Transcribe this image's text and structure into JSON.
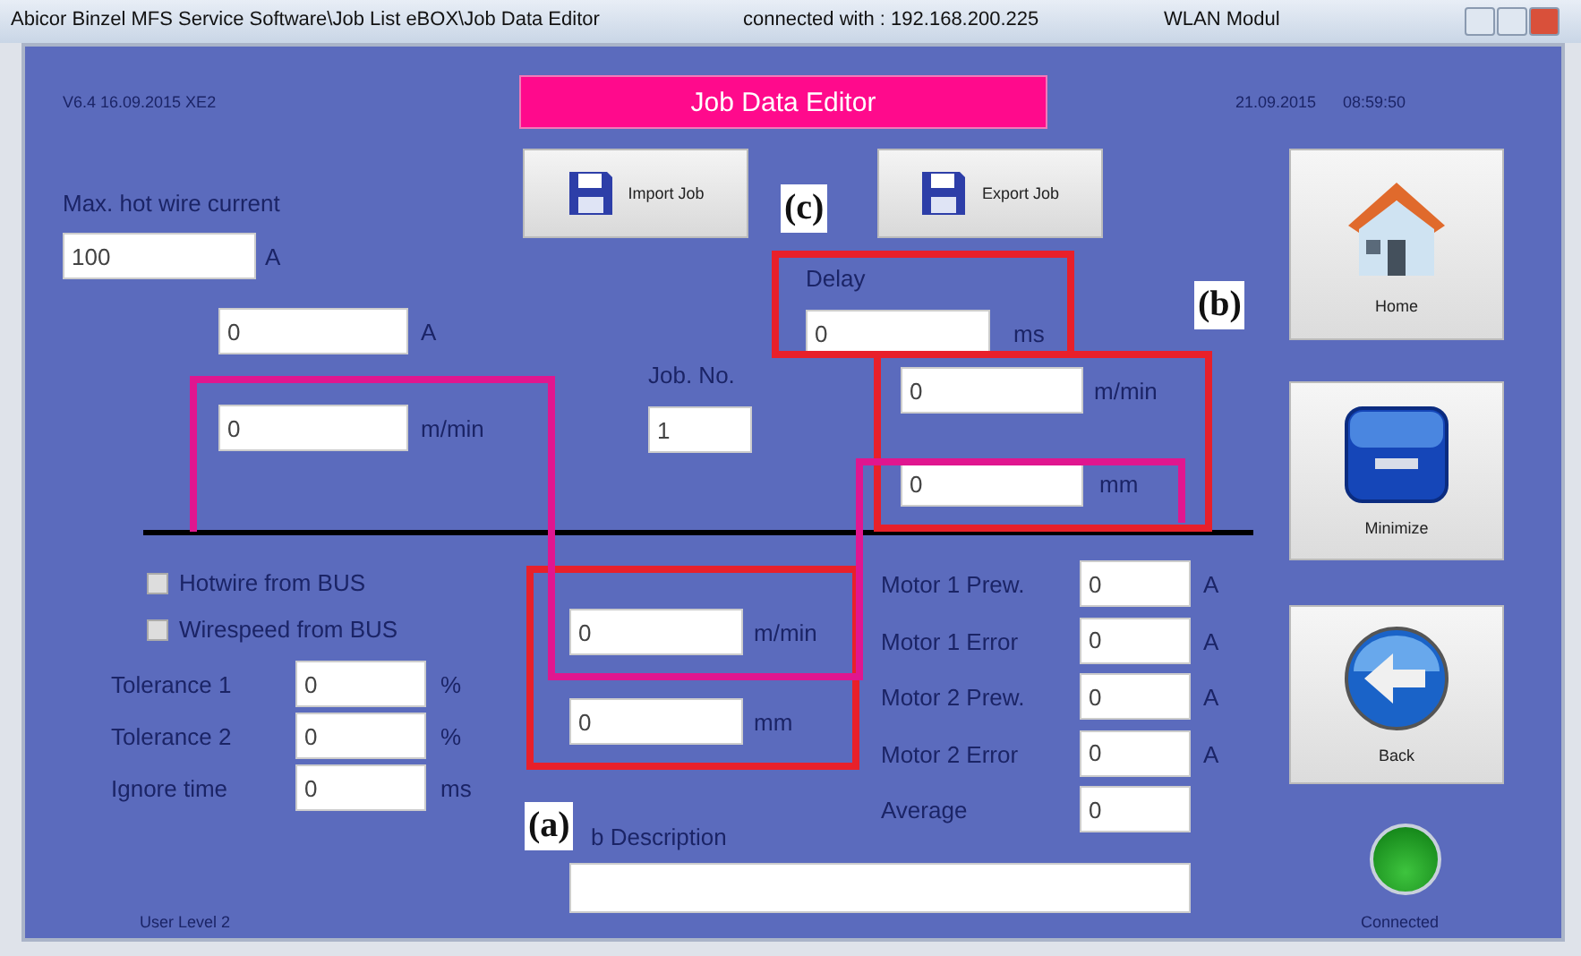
{
  "window": {
    "title": "Abicor Binzel MFS Service Software\\Job List eBOX\\Job Data Editor",
    "connection": "connected with : 192.168.200.225",
    "module": "WLAN Modul"
  },
  "header": {
    "version": "V6.4 16.09.2015 XE2",
    "title": "Job Data Editor",
    "date": "21.09.2015",
    "time": "08:59:50"
  },
  "toolbar": [
    {
      "label": "Import Job"
    },
    {
      "label": "Export Job"
    }
  ],
  "fields": [
    {
      "label": "Max. hot wire current",
      "value": "100",
      "unit": "A"
    },
    {
      "value": "0",
      "unit": "A"
    },
    {
      "value": "0",
      "unit": "m/min"
    },
    {
      "label": "Job. No.",
      "value": "1"
    },
    {
      "label": "Delay",
      "value": "0",
      "unit": "ms"
    },
    {
      "value": "0",
      "unit": "m/min"
    },
    {
      "value": "0",
      "unit": "mm"
    },
    {
      "value": "0",
      "unit": "m/min"
    },
    {
      "value": "0",
      "unit": "mm"
    }
  ],
  "checkboxes": [
    {
      "label": "Hotwire from BUS",
      "checked": false
    },
    {
      "label": "Wirespeed from BUS",
      "checked": false
    }
  ],
  "tolerances": [
    {
      "label": "Tolerance 1",
      "value": "0",
      "unit": "%"
    },
    {
      "label": "Tolerance 2",
      "value": "0",
      "unit": "%"
    },
    {
      "label": "Ignore time",
      "value": "0",
      "unit": "ms"
    }
  ],
  "motors": [
    {
      "label": "Motor 1 Prew.",
      "value": "0",
      "unit": "A"
    },
    {
      "label": "Motor 1 Error",
      "value": "0",
      "unit": "A"
    },
    {
      "label": "Motor 2 Prew.",
      "value": "0",
      "unit": "A"
    },
    {
      "label": "Motor 2 Error",
      "value": "0",
      "unit": "A"
    },
    {
      "label": "Average",
      "value": "0"
    }
  ],
  "description": {
    "label": "b Description"
  },
  "nav_buttons": [
    {
      "label": "Home",
      "kind": "home"
    },
    {
      "label": "Minimize",
      "kind": "minimize"
    },
    {
      "label": "Back",
      "kind": "back"
    }
  ],
  "status": {
    "user_level": "User Level 2",
    "label": "Connected",
    "connected": true
  },
  "annotations": [
    {
      "label": "(c)",
      "color": "#e8202a"
    },
    {
      "label": "(b)",
      "color": "#e8202a"
    },
    {
      "label": "(a)",
      "color": "#e8202a"
    },
    {
      "color": "#e0168f"
    }
  ]
}
